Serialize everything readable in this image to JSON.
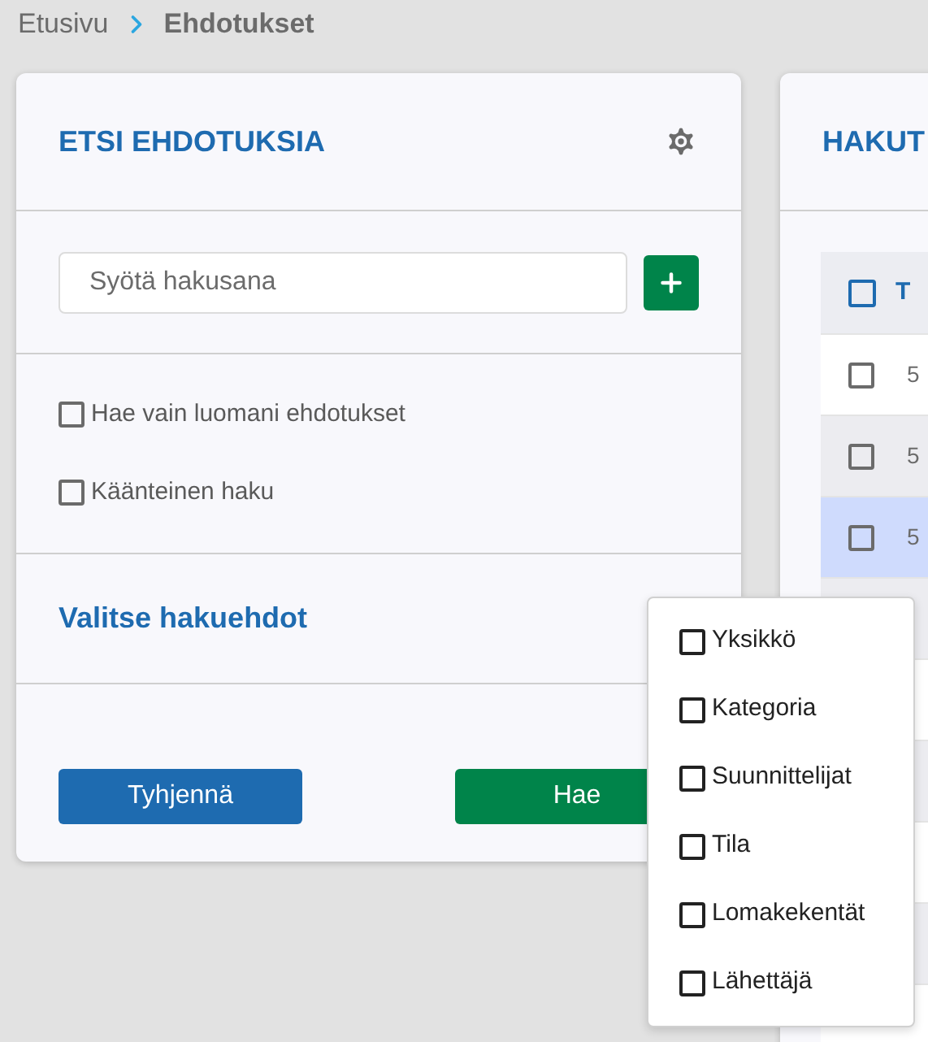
{
  "breadcrumb": {
    "items": [
      "Etusivu",
      "Ehdotukset"
    ]
  },
  "search_panel": {
    "title": "ETSI EHDOTUKSIA",
    "search": {
      "placeholder": "Syötä hakusana"
    },
    "options": [
      {
        "label": "Hae vain luomani ehdotukset",
        "checked": false
      },
      {
        "label": "Käänteinen haku",
        "checked": false
      }
    ],
    "criteria_title": "Valitse hakuehdot",
    "buttons": [
      "Tyhjennä",
      "Hae"
    ]
  },
  "results_panel": {
    "title": "HAKUT",
    "table": {
      "header": "T",
      "select_all_checked": false,
      "rows": [
        {
          "column_1": "5",
          "checked": false,
          "selected": false
        },
        {
          "column_1": "5",
          "checked": false,
          "selected": false
        },
        {
          "column_1": "5",
          "checked": false,
          "selected": true
        }
      ]
    }
  },
  "criteria_menu": {
    "items": [
      {
        "label": "Yksikkö",
        "checked": false
      },
      {
        "label": "Kategoria",
        "checked": false
      },
      {
        "label": "Suunnittelijat",
        "checked": false
      },
      {
        "label": "Tila",
        "checked": false
      },
      {
        "label": "Lomakekentät",
        "checked": false
      },
      {
        "label": "Lähettäjä",
        "checked": false
      }
    ]
  }
}
